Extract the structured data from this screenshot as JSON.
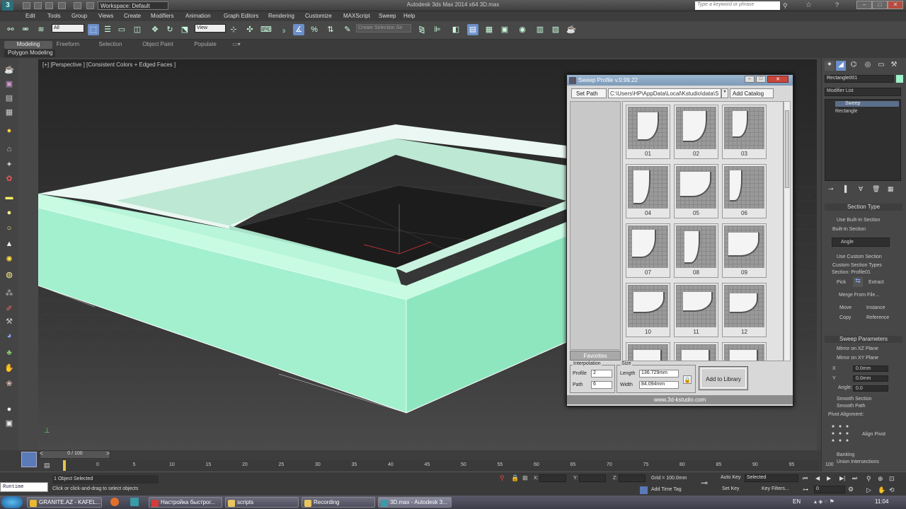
{
  "titlebar": {
    "title": "Autodesk 3ds Max  2014 x64      3D.max",
    "workspace": "Workspace: Default",
    "search_placeholder": "Type a keyword or phrase"
  },
  "menu": [
    "Edit",
    "Tools",
    "Group",
    "Views",
    "Create",
    "Modifiers",
    "Animation",
    "Graph Editors",
    "Rendering",
    "Customize",
    "MAXScript",
    "Sweep",
    "Help"
  ],
  "toolbar": {
    "filter_value": "All",
    "refcoord_value": "View",
    "selection_set_placeholder": "Create Selection Se"
  },
  "ribbon": {
    "tabs": [
      "Modeling",
      "Freeform",
      "Selection",
      "Object Paint",
      "Populate"
    ],
    "active_tab": "Modeling",
    "sub_label": "Polygon Modeling"
  },
  "viewport": {
    "label": "[+] [Perspective ] [Consistent Colors + Edged Faces ]",
    "object_color": "#9ef2c8"
  },
  "dialog": {
    "title": "Sweep Profile v.0.99.22",
    "set_path_label": "Set Path",
    "path_value": "C:\\Users\\HP\\AppData\\Local\\Kstudio\\data\\S",
    "add_catalog_label": "Add Catalog",
    "favorites_label": "Favorites",
    "profiles": [
      "01",
      "02",
      "03",
      "04",
      "05",
      "06",
      "07",
      "08",
      "09",
      "10",
      "11",
      "12"
    ],
    "interpolation_label": "Interpolation",
    "profile_label": "Profile",
    "profile_value": "2",
    "path_label": "Path",
    "path_interp_value": "6",
    "size_label": "Size",
    "length_label": "Length",
    "length_value": "136.729mm",
    "width_label": "Width",
    "width_value": "84.094mm",
    "add_library_label": "Add to Library",
    "website": "www.3d-kstudio.com"
  },
  "cmdpanel": {
    "object_name": "Rectangle001",
    "modifier_list": "Modifier List",
    "stack": [
      "Sweep",
      "Rectangle"
    ],
    "section_type_title": "Section Type",
    "use_builtin": "Use Built-In Section",
    "builtin_section": "Built-In Section",
    "builtin_value": "Angle",
    "use_custom": "Use Custom Section",
    "custom_types": "Custom Section Types",
    "section_name": "Section: Profile01",
    "pick": "Pick",
    "extract": "Extract",
    "merge": "Merge From File...",
    "move": "Move",
    "instance": "Instance",
    "copy": "Copy",
    "reference": "Reference",
    "sweep_params_title": "Sweep Parameters",
    "mirror_xz": "Mirror on XZ Plane",
    "mirror_xy": "Mirror on XY Plane",
    "x_label": "X",
    "x_value": "0.0mm",
    "y_label": "Y",
    "y_value": "0.0mm",
    "angle_label": "Angle:",
    "angle_value": "0.0",
    "smooth_section": "Smooth Section",
    "smooth_path": "Smooth Path",
    "pivot_alignment": "Pivot Alignment:",
    "align_pivot": "Align Pivot",
    "banking": "Banking",
    "union": "Union Intersections"
  },
  "timeline": {
    "frame": "0 / 100",
    "ticks": [
      "0",
      "5",
      "10",
      "15",
      "20",
      "25",
      "30",
      "35",
      "40",
      "45",
      "50",
      "55",
      "60",
      "65",
      "70",
      "75",
      "80",
      "85",
      "90",
      "95",
      "100"
    ]
  },
  "status": {
    "maxscript": "Runtime",
    "selected": "1 Object Selected",
    "prompt": "Click or click-and-drag to select objects",
    "x_label": "X:",
    "y_label": "Y:",
    "z_label": "Z:",
    "grid": "Grid = 100.0mm",
    "add_time_tag": "Add Time Tag",
    "auto_key": "Auto Key",
    "set_key": "Set Key",
    "selected_dd": "Selected",
    "key_filters": "Key Filters...",
    "frame_value": "0"
  },
  "taskbar": {
    "items": [
      "GRANITE.AZ - KAFEL...",
      "Настройка быстрог...",
      "scripts",
      "Recording",
      "3D.max - Autodesk 3..."
    ],
    "lang": "EN",
    "clock": "11:04"
  }
}
